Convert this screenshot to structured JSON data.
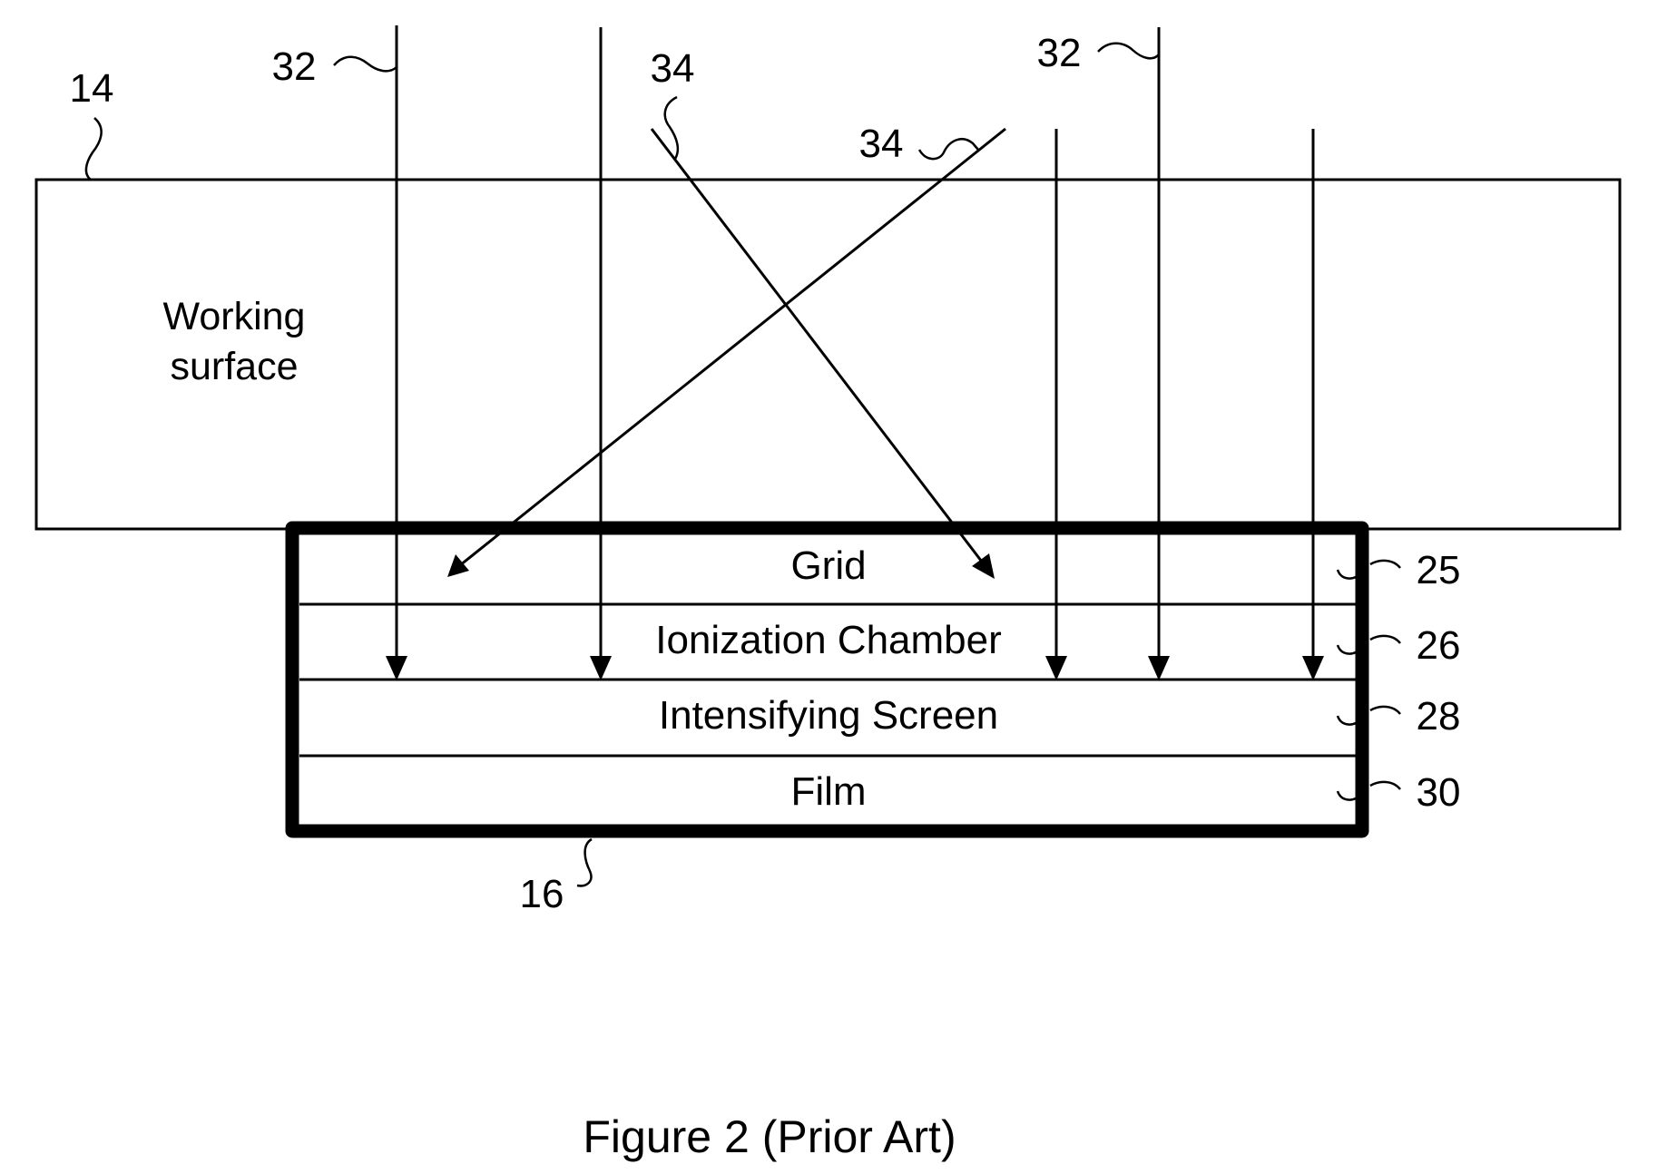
{
  "figure": {
    "caption": "Figure 2 (Prior Art)",
    "working_surface": {
      "ref": "14",
      "label_lines": [
        "Working",
        "surface"
      ]
    },
    "cassette": {
      "ref": "16",
      "layers": [
        {
          "name": "Grid",
          "ref": "25"
        },
        {
          "name": "Ionization Chamber",
          "ref": "26"
        },
        {
          "name": "Intensifying Screen",
          "ref": "28"
        },
        {
          "name": "Film",
          "ref": "30"
        }
      ]
    },
    "rays": {
      "primary_ref": "32",
      "scattered_ref": "34",
      "primary_labels": [
        "32",
        "32"
      ],
      "scattered_labels": [
        "34",
        "34"
      ],
      "primary_count": 5,
      "scattered_count": 2
    }
  }
}
